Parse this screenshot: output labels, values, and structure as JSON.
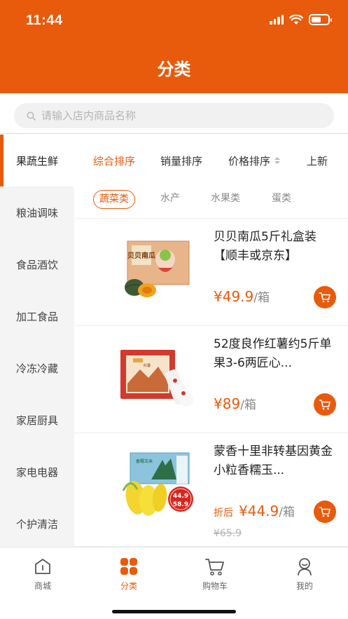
{
  "status": {
    "time": "11:44"
  },
  "header": {
    "title": "分类"
  },
  "search": {
    "placeholder": "请输入店内商品名称"
  },
  "sidebar": {
    "items": [
      {
        "label": "果蔬生鲜",
        "active": true
      },
      {
        "label": "粮油调味"
      },
      {
        "label": "食品酒饮"
      },
      {
        "label": "加工食品"
      },
      {
        "label": "冷冻冷藏"
      },
      {
        "label": "家居厨具"
      },
      {
        "label": "家电电器"
      },
      {
        "label": "个护清洁"
      }
    ]
  },
  "sort": {
    "items": [
      {
        "label": "综合排序",
        "active": true
      },
      {
        "label": "销量排序"
      },
      {
        "label": "价格排序"
      },
      {
        "label": "上新"
      }
    ]
  },
  "subtabs": {
    "items": [
      {
        "label": "蔬菜类",
        "active": true
      },
      {
        "label": "水产"
      },
      {
        "label": "水果类"
      },
      {
        "label": "蛋类"
      }
    ]
  },
  "products": [
    {
      "name": "贝贝南瓜5斤礼盒装【顺丰或京东】",
      "price": "¥49.9",
      "unit": "/箱",
      "image_text": "贝贝南瓜"
    },
    {
      "name": "52度良作红薯约5斤单果3-6两匠心...",
      "price": "¥89",
      "unit": "/箱",
      "image_text": "红薯"
    },
    {
      "name": "蒙香十里非转基因黄金小粒香糯玉...",
      "prefix": "折后",
      "price": "¥44.9",
      "unit": "/箱",
      "old_price": "¥65.9",
      "image_text": "香糯玉米",
      "badge_top": "44.9",
      "badge_bottom": "58.9"
    }
  ],
  "tabbar": {
    "items": [
      {
        "label": "商城",
        "icon": "home-icon"
      },
      {
        "label": "分类",
        "icon": "category-icon",
        "active": true
      },
      {
        "label": "购物车",
        "icon": "cart-icon"
      },
      {
        "label": "我的",
        "icon": "profile-icon"
      }
    ]
  },
  "colors": {
    "accent": "#E85A0C",
    "sidebar_bg": "#F4F4F4"
  }
}
